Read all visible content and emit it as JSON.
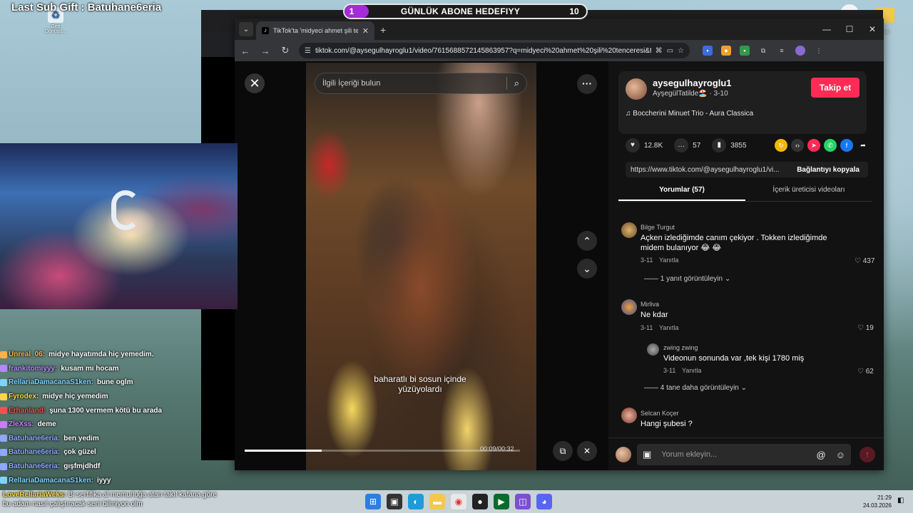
{
  "overlay": {
    "sub_gift": "Last Sub Gift : Batuhane6eria",
    "recycle_label": "Geri Dönüşü...",
    "goal": {
      "current": "1",
      "title": "GÜNLÜK ABONE HEDEFIYY",
      "target": "10",
      "progress": 0.1
    },
    "desktop_right_label": "üstü"
  },
  "browser": {
    "tab_title": "TikTok'ta 'midyeci ahmet şili tencere'",
    "url": "tiktok.com/@aysegulhayroglu1/video/7615688572145863957?q=midyeci%20ahmet%20şili%20tenceresi&t=177437..."
  },
  "video": {
    "search_placeholder": "İlgili İçeriği bulun",
    "caption": "baharatlı bi sosun içinde yüzüyolardı",
    "time": "00:09/00:32",
    "progress": 0.28
  },
  "author": {
    "username": "aysegulhayroglu1",
    "display": "AyşegülTatilde🏖️",
    "date": "3-10",
    "follow_label": "Takip et",
    "music": "Boccherini Minuet Trio - Aura Classica"
  },
  "stats": {
    "likes": "12.8K",
    "comments": "57",
    "saves": "3855"
  },
  "link": {
    "url": "https://www.tiktok.com/@aysegulhayroglu1/vi...",
    "copy_label": "Bağlantıyı kopyala"
  },
  "panel_tabs": {
    "comments": "Yorumlar (57)",
    "creator": "İçerik üreticisi videoları"
  },
  "comments": [
    {
      "name": "Bilge Turgut",
      "text1": "Açken izlediğimde canım çekiyor . Tokken izlediğimde",
      "text2": "midem bulanıyor 😂 😂",
      "date": "3-11",
      "reply": "Yanıtla",
      "likes": "437",
      "view_replies": "1 yanıt görüntüleyin"
    },
    {
      "name": "Mirliva",
      "text1": "Ne kdar",
      "text2": "",
      "date": "3-11",
      "reply": "Yanıtla",
      "likes": "19"
    },
    {
      "name": "zwing zwing",
      "text1": "Videonun sonunda var ,tek kişi 1780 miş",
      "text2": "",
      "date": "3-11",
      "reply": "Yanıtla",
      "likes": "62",
      "view_replies": "4 tane daha görüntüleyin"
    },
    {
      "name": "Selcan Koçer",
      "text1": "Hangi şubesi ?",
      "text2": ""
    }
  ],
  "comment_box": {
    "placeholder": "Yorum ekleyin..."
  },
  "chat": [
    {
      "user": "Unreal_06:",
      "msg": "midye hayatımda hiç yemedim.",
      "color": "#ffb04a"
    },
    {
      "user": "frankitomiyyy:",
      "msg": "kusam mı hocam",
      "color": "#b388ff"
    },
    {
      "user": "RellariaDamacanaS1ken:",
      "msg": "bune oglm",
      "color": "#7fd3ff"
    },
    {
      "user": "Fyrodex:",
      "msg": "midye hiç yemedim",
      "color": "#ffd54a"
    },
    {
      "user": "Erhanland:",
      "msg": "şuna 1300 vermem kötü bu arada",
      "color": "#ff4d4d"
    },
    {
      "user": "ZleXss:",
      "msg": "deme",
      "color": "#c77dff"
    },
    {
      "user": "Batuhane6eria:",
      "msg": "ben yedim",
      "color": "#8fa8ff"
    },
    {
      "user": "Batuhane6eria:",
      "msg": "çok güzel",
      "color": "#8fa8ff"
    },
    {
      "user": "Batuhane6eria:",
      "msg": "gışfmjdhdf",
      "color": "#8fa8ff"
    },
    {
      "user": "RellariaDamacanaS1ken:",
      "msg": "iyyy",
      "color": "#7fd3ff"
    }
  ],
  "bottom_alert": {
    "user": "LoveRellariaWeks:",
    "text": "Bi sertifika al memurluğa atan takıl kafana göre bu adam nasıl çalıştıracak seni bilmiyon olm"
  },
  "clock": {
    "time": "21:29",
    "date": "24.03.2026"
  }
}
